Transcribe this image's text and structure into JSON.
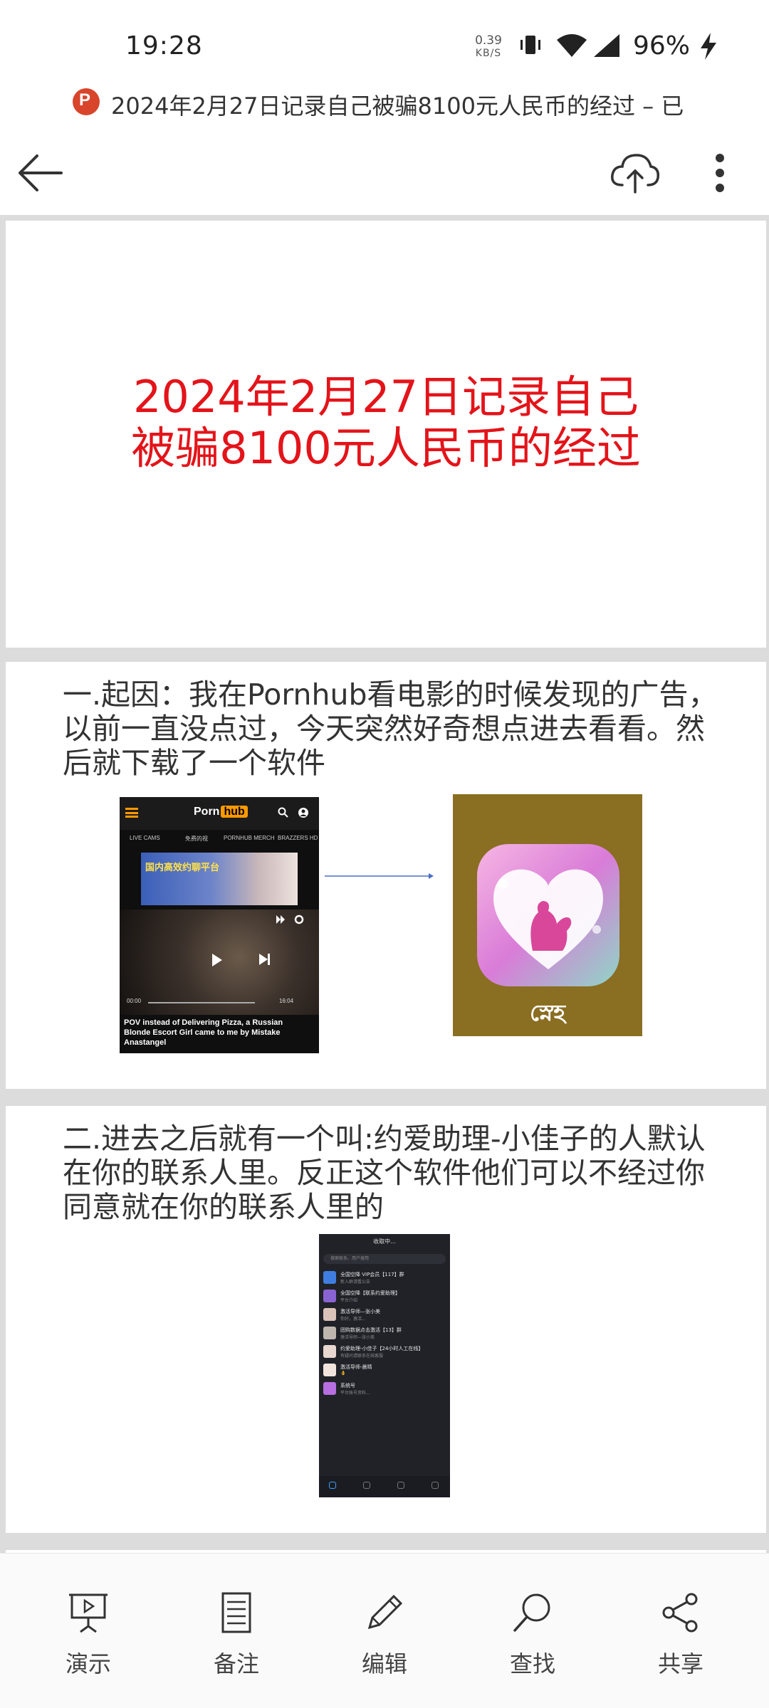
{
  "status_bar": {
    "time": "19:28",
    "net_speed_value": "0.39",
    "net_speed_unit": "KB/S",
    "battery": "96%"
  },
  "document": {
    "file_title": "2024年2月27日记录自己被骗8100元人民币的经过 – 已",
    "app_icon_letter": "P"
  },
  "slides": [
    {
      "title_lines": [
        "2024年2月27日记录自己",
        "被骗8100元人民币的经过"
      ]
    },
    {
      "body": "一.起因：我在Pornhub看电影的时候发现的广告，以前一直没点过，今天突然好奇想点进去看看。然后就下载了一个软件",
      "screenshot": {
        "logo_a": "Porn",
        "logo_b": "hub",
        "nav": [
          "LIVE CAMS",
          "免费的视",
          "PORNHUB MERCH",
          "BRAZZERS HD"
        ],
        "banner_text": "国内高效约聊平台",
        "time_start": "00:00",
        "time_end": "16:04",
        "caption": "POV instead of Delivering Pizza, a Russian Blonde Escort Girl came to me by Mistake Anastangel"
      },
      "app_label": "স্নেহ"
    },
    {
      "body": "二.进去之后就有一个叫:约爱助理-小佳子的人默认在你的联系人里。反正这个软件他们可以不经过你同意就在你的联系人里的",
      "chat": {
        "header": "收取中...",
        "search_placeholder": "搜索联系、用户搜用",
        "rows": [
          {
            "name": "全国空降 VIP会员【117】群",
            "msg": "新入群请看公告",
            "color": "#3f7ee0"
          },
          {
            "name": "全国空降【联系约爱助理】",
            "msg": "平台介绍",
            "color": "#8a63d2"
          },
          {
            "name": "激活导师—张小美",
            "msg": "你好，激活...",
            "color": "#d9c2b8"
          },
          {
            "name": "团购数据点击激活【13】群",
            "msg": "激活导师—张小美",
            "color": "#bfb7ae"
          },
          {
            "name": "约爱助理-小佳子【24小时人工在线】",
            "msg": "有疑问请联系在线客服",
            "color": "#e8d7cf"
          },
          {
            "name": "激活导师-晨晴",
            "msg": "👌",
            "color": "#f0e4dc"
          },
          {
            "name": "系统号",
            "msg": "平台账号资料...",
            "color": "#b66ee0"
          }
        ]
      }
    }
  ],
  "bottom_bar": [
    {
      "label": "演示",
      "icon": "presentation-icon"
    },
    {
      "label": "备注",
      "icon": "notes-icon"
    },
    {
      "label": "编辑",
      "icon": "pencil-icon"
    },
    {
      "label": "查找",
      "icon": "search-icon"
    },
    {
      "label": "共享",
      "icon": "share-icon"
    }
  ],
  "colors": {
    "title_red": "#e3141a",
    "canvas_gray": "#dcdcdc",
    "ppt_orange": "#d8452b"
  }
}
